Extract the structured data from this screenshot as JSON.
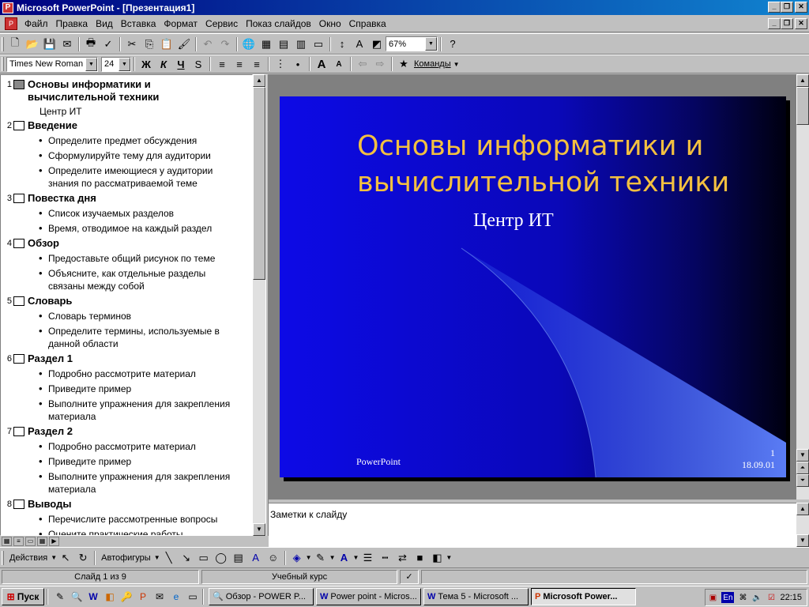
{
  "window": {
    "title": "Microsoft PowerPoint - [Презентация1]"
  },
  "menu": [
    "Файл",
    "Правка",
    "Вид",
    "Вставка",
    "Формат",
    "Сервис",
    "Показ слайдов",
    "Окно",
    "Справка"
  ],
  "toolbar": {
    "zoom": "67%",
    "font": "Times New Roman",
    "font_size": "24",
    "bold": "Ж",
    "italic": "К",
    "underline": "Ч",
    "commands_label": "Команды"
  },
  "outline": [
    {
      "num": "1",
      "title": "Основы информатики и вычислительной техники",
      "subtitle": "Центр ИТ",
      "bullets": []
    },
    {
      "num": "2",
      "title": "Введение",
      "bullets": [
        "Определите предмет обсуждения",
        "Сформулируйте тему для аудитории",
        "Определите имеющиеся у аудитории знания по рассматриваемой теме"
      ]
    },
    {
      "num": "3",
      "title": "Повестка дня",
      "bullets": [
        "Список изучаемых разделов",
        "Время, отводимое на каждый раздел"
      ]
    },
    {
      "num": "4",
      "title": "Обзор",
      "bullets": [
        "Предоставьте общий рисунок по теме",
        "Объясните, как отдельные разделы связаны между собой"
      ]
    },
    {
      "num": "5",
      "title": "Словарь",
      "bullets": [
        "Словарь терминов",
        "Определите термины, используемые в данной области"
      ]
    },
    {
      "num": "6",
      "title": "Раздел 1",
      "bullets": [
        "Подробно рассмотрите материал",
        "Приведите пример",
        "Выполните упражнения для закрепления материала"
      ]
    },
    {
      "num": "7",
      "title": "Раздел 2",
      "bullets": [
        "Подробно рассмотрите материал",
        "Приведите пример",
        "Выполните упражнения для закрепления материала"
      ]
    },
    {
      "num": "8",
      "title": "Выводы",
      "bullets": [
        "Перечислите рассмотренные вопросы",
        "Оцените практические работы"
      ]
    }
  ],
  "slide": {
    "title": "Основы информатики и вычислительной техники",
    "subtitle": "Центр ИТ",
    "footer": "PowerPoint",
    "number": "1",
    "date": "18.09.01",
    "title_color": "#f3c040",
    "bg_color": "#0d0ae6"
  },
  "notes": {
    "placeholder": "Заметки к слайду"
  },
  "drawbar": {
    "actions": "Действия",
    "autoshapes": "Автофигуры"
  },
  "status": {
    "slide": "Слайд 1 из 9",
    "design": "Учебный курс"
  },
  "taskbar": {
    "start": "Пуск",
    "tasks": [
      "Обзор - POWER P...",
      "Power point - Micros...",
      "Тема 5 - Microsoft ...",
      "Microsoft Power..."
    ],
    "time": "22:15",
    "lang": "En"
  }
}
